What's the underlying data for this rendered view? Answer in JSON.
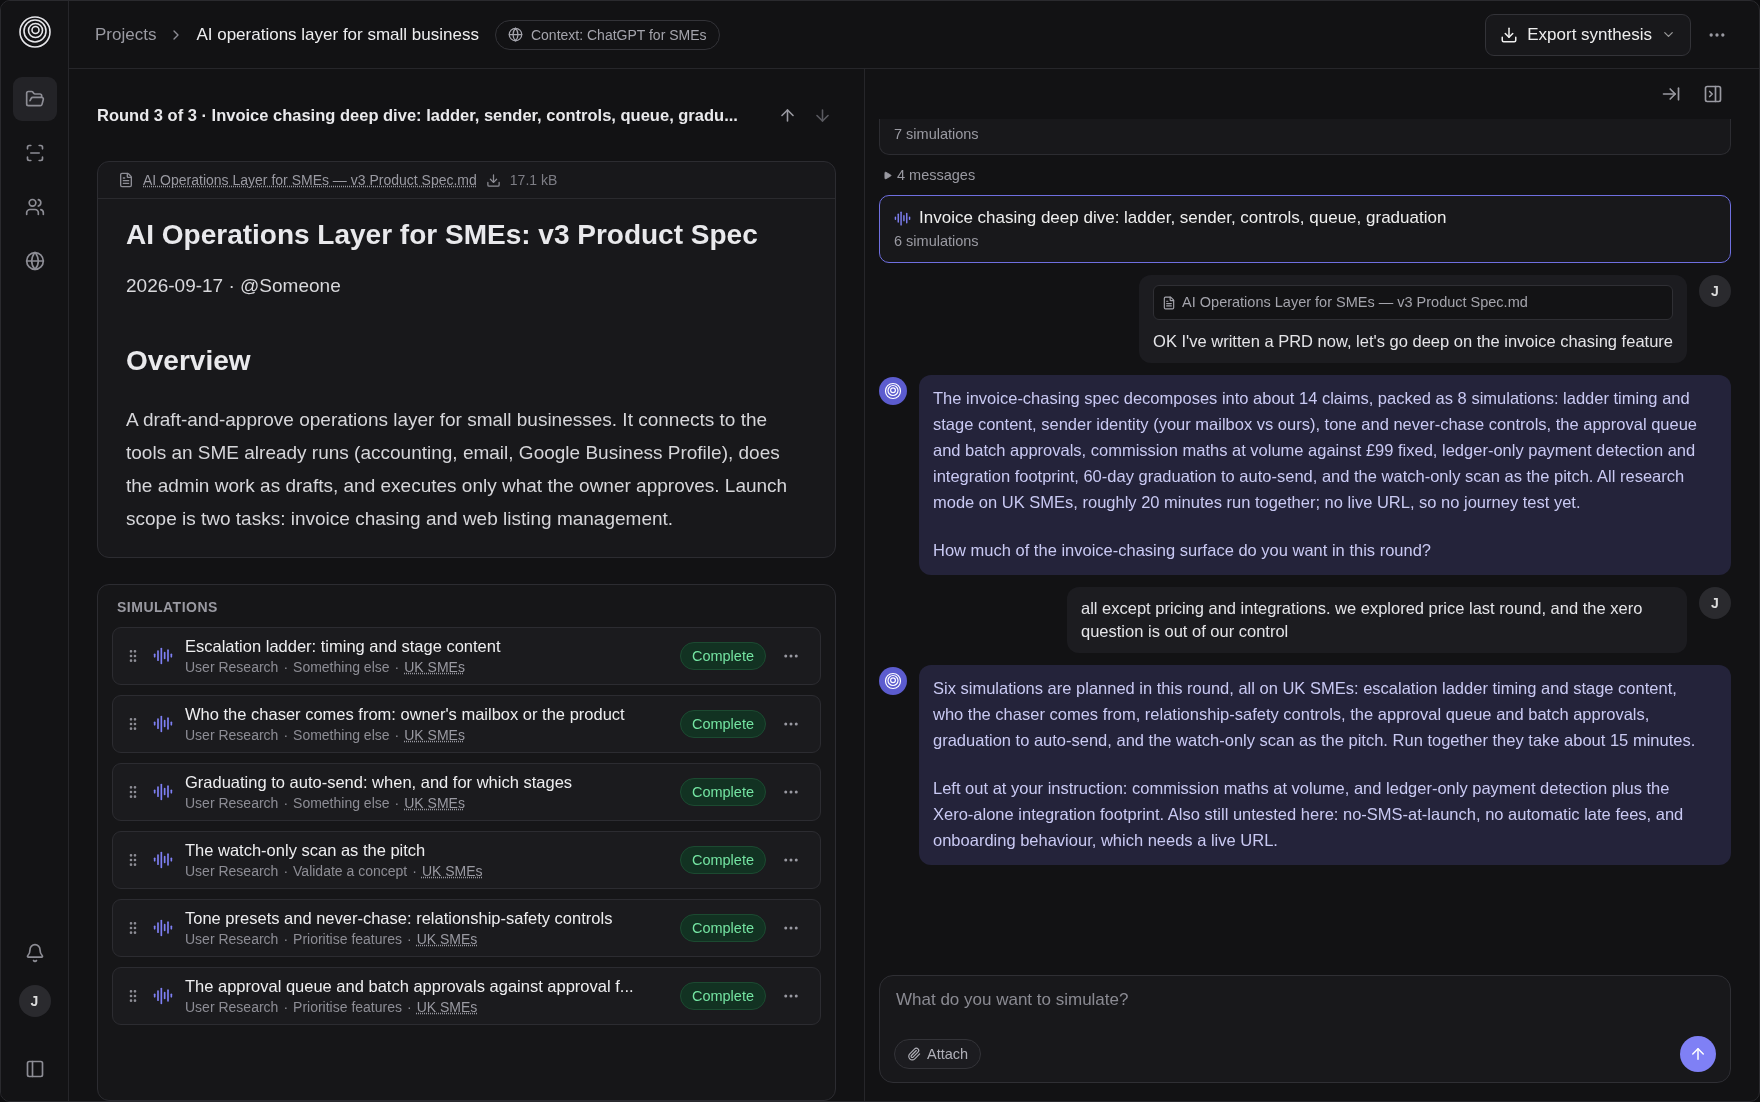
{
  "breadcrumb": {
    "items": [
      "Projects",
      "AI operations layer for small business"
    ],
    "context": "Context: ChatGPT for SMEs"
  },
  "export_button": "Export synthesis",
  "user_avatar": "J",
  "round_header": "Round 3 of 3 · Invoice chasing deep dive: ladder, sender, controls, queue, gradu...",
  "document": {
    "filename": "AI Operations Layer for SMEs — v3 Product Spec.md",
    "size": "17.1 kB",
    "title": "AI Operations Layer for SMEs: v3 Product Spec",
    "meta": "2026-09-17 · @Someone",
    "heading": "Overview",
    "paragraph": "A draft-and-approve operations layer for small businesses. It connects to the tools an SME already runs (accounting, email, Google Business Profile), does the admin work as drafts, and executes only what the owner approves. Launch scope is two tasks: invoice chasing and web listing management."
  },
  "simulations": {
    "heading": "SIMULATIONS",
    "separator": "·",
    "items": [
      {
        "title": "Escalation ladder: timing and stage content",
        "type": "User Research",
        "goal": "Something else",
        "audience": "UK SMEs",
        "status": "Complete"
      },
      {
        "title": "Who the chaser comes from: owner's mailbox or the product",
        "type": "User Research",
        "goal": "Something else",
        "audience": "UK SMEs",
        "status": "Complete"
      },
      {
        "title": "Graduating to auto-send: when, and for which stages",
        "type": "User Research",
        "goal": "Something else",
        "audience": "UK SMEs",
        "status": "Complete"
      },
      {
        "title": "The watch-only scan as the pitch",
        "type": "User Research",
        "goal": "Validate a concept",
        "audience": "UK SMEs",
        "status": "Complete"
      },
      {
        "title": "Tone presets and never-chase: relationship-safety controls",
        "type": "User Research",
        "goal": "Prioritise features",
        "audience": "UK SMEs",
        "status": "Complete"
      },
      {
        "title": "The approval queue and batch approvals against approval f...",
        "type": "User Research",
        "goal": "Prioritise features",
        "audience": "UK SMEs",
        "status": "Complete"
      }
    ]
  },
  "chat": {
    "items": [
      {
        "kind": "round",
        "count": "7 simulations",
        "selected": false
      },
      {
        "kind": "toggle",
        "label": "4 messages",
        "expanded": false
      },
      {
        "kind": "round",
        "title": "Invoice chasing deep dive: ladder, sender, controls, queue, graduation",
        "count": "6 simulations",
        "selected": true
      },
      {
        "kind": "user",
        "avatar": "J",
        "attachment": "AI Operations Layer for SMEs — v3 Product Spec.md",
        "paragraphs": [
          "OK I've written a PRD now, let's go deep on the invoice chasing feature"
        ]
      },
      {
        "kind": "assistant",
        "paragraphs": [
          "The invoice-chasing spec decomposes into about 14 claims, packed as 8 simulations: ladder timing and stage content, sender identity (your mailbox vs ours), tone and never-chase controls, the approval queue and batch approvals, commission maths at volume against £99 fixed, ledger-only payment detection and integration footprint, 60-day graduation to auto-send, and the watch-only scan as the pitch. All research mode on UK SMEs, roughly 20 minutes run together; no live URL, so no journey test yet.",
          "How much of the invoice-chasing surface do you want in this round?"
        ]
      },
      {
        "kind": "user",
        "avatar": "J",
        "paragraphs": [
          "all except pricing and integrations. we explored price last round, and the xero question is out of our control"
        ]
      },
      {
        "kind": "assistant",
        "paragraphs": [
          "Six simulations are planned in this round, all on UK SMEs: escalation ladder timing and stage content, who the chaser comes from, relationship-safety controls, the approval queue and batch approvals, graduation to auto-send, and the watch-only scan as the pitch. Run together they take about 15 minutes.",
          "Left out at your instruction: commission maths at volume, and ledger-only payment detection plus the Xero-alone integration footprint. Also still untested here: no-SMS-at-launch, no automatic late fees, and onboarding behaviour, which needs a live URL."
        ]
      }
    ]
  },
  "composer": {
    "placeholder": "What do you want to simulate?",
    "attach": "Attach"
  }
}
